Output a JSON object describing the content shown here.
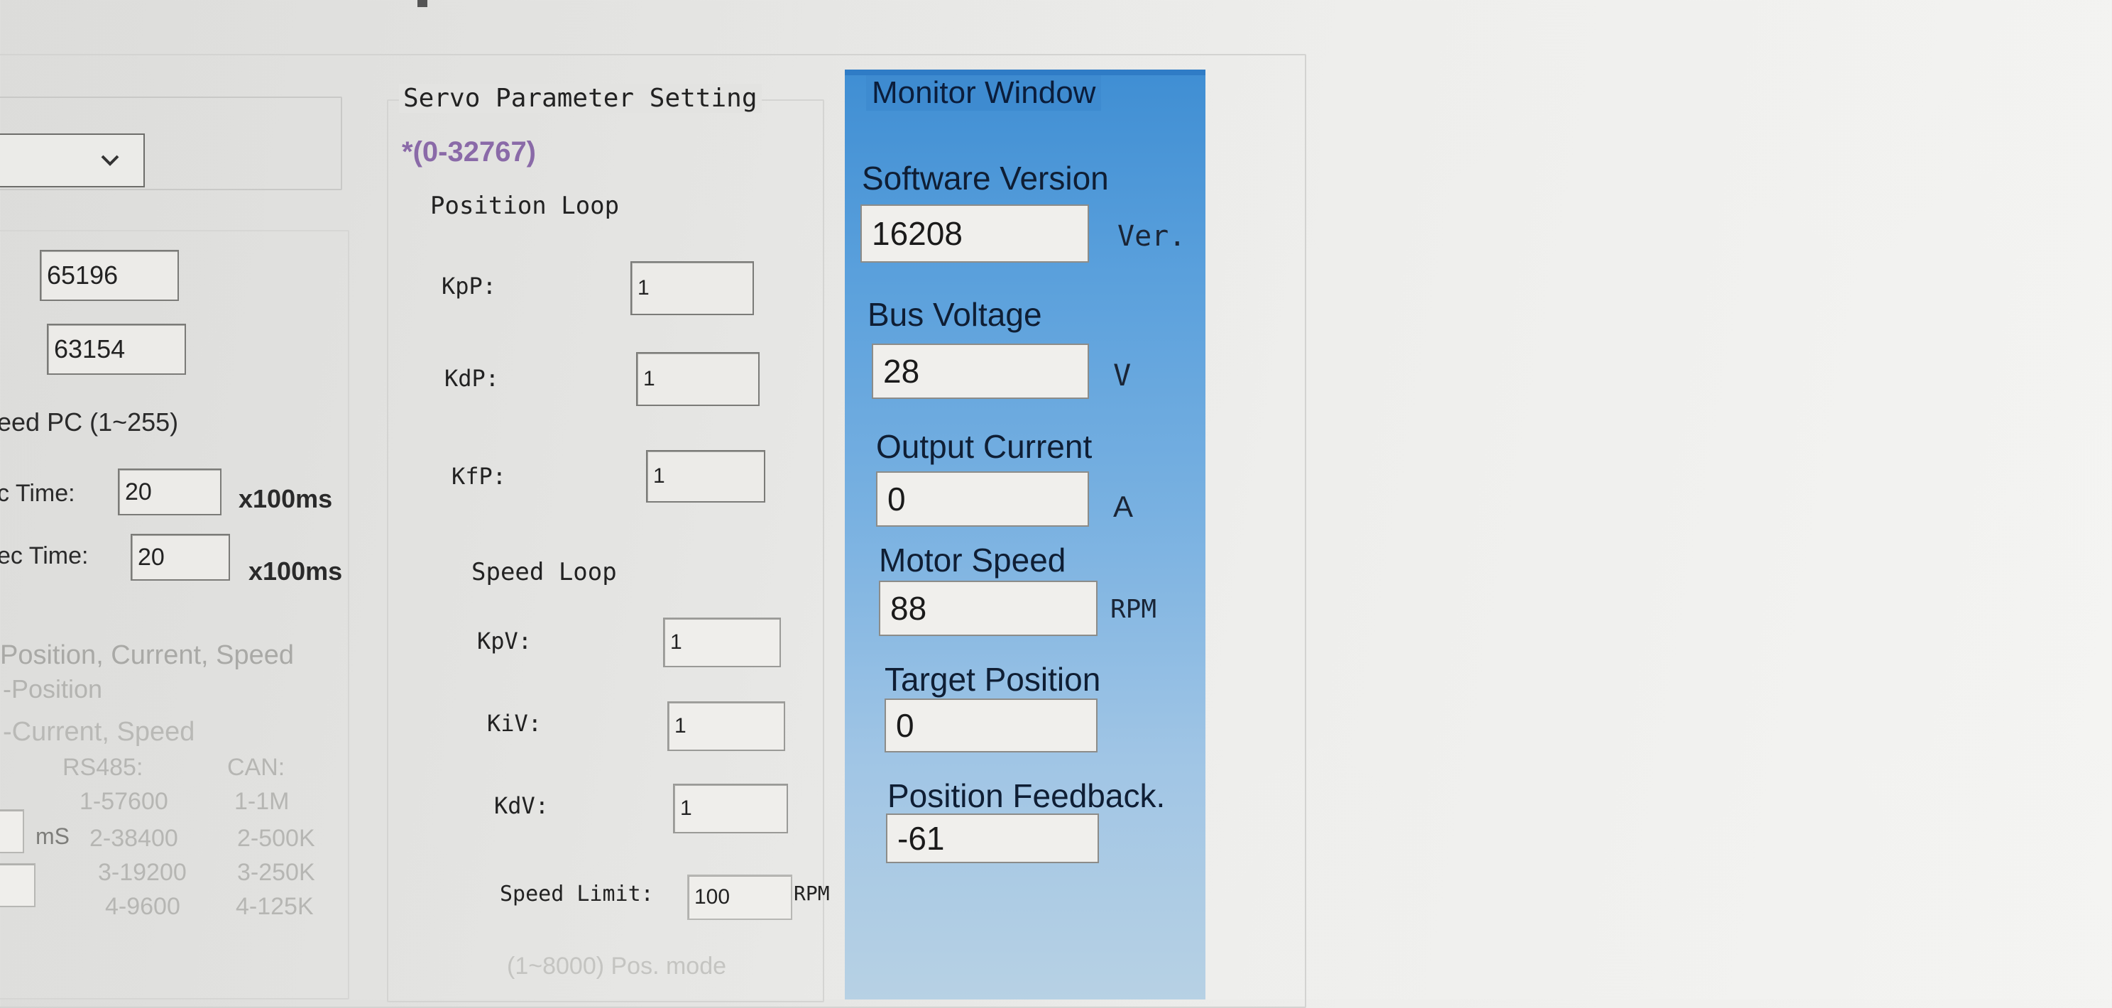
{
  "left_panel": {
    "field_1": "65196",
    "field_2": "63154",
    "speed_pc_label": "eed PC (1~255)",
    "acc_time_label": "c Time:",
    "acc_time_value": "20",
    "acc_time_unit": "x100ms",
    "dec_time_label": "ec Time:",
    "dec_time_value": "20",
    "dec_time_unit": "x100ms",
    "mode_line_1": "Position, Current, Speed",
    "mode_line_2": "-Position",
    "mode_line_3": "-Current, Speed",
    "baud_header_rs485": "RS485:",
    "baud_header_can": "CAN:",
    "ms_label": "mS",
    "rs485_options": [
      "1-57600",
      "2-38400",
      "3-19200",
      "4-9600"
    ],
    "can_options": [
      "1-1M",
      "2-500K",
      "3-250K",
      "4-125K"
    ]
  },
  "servo": {
    "title": "Servo Parameter Setting",
    "range_note": "*(0-32767)",
    "position_loop": "Position Loop",
    "kpp_label": "KpP:",
    "kpp_value": "1",
    "kdp_label": "KdP:",
    "kdp_value": "1",
    "kfp_label": "KfP:",
    "kfp_value": "1",
    "speed_loop": "Speed Loop",
    "kpv_label": "KpV:",
    "kpv_value": "1",
    "kiv_label": "KiV:",
    "kiv_value": "1",
    "kdv_label": "KdV:",
    "kdv_value": "1",
    "speed_limit_label": "Speed Limit:",
    "speed_limit_value": "100",
    "speed_limit_unit": "RPM",
    "bottom_note": "(1~8000) Pos. mode"
  },
  "monitor": {
    "title": "Monitor Window",
    "software_version_label": "Software Version",
    "software_version_value": "16208",
    "software_version_unit": "Ver.",
    "bus_voltage_label": "Bus Voltage",
    "bus_voltage_value": "28",
    "bus_voltage_unit": "V",
    "output_current_label": "Output Current",
    "output_current_value": "0",
    "output_current_unit": "A",
    "motor_speed_label": "Motor Speed",
    "motor_speed_value": "88",
    "motor_speed_unit": "RPM",
    "target_position_label": "Target Position",
    "target_position_value": "0",
    "position_feedback_label": "Position Feedback.",
    "position_feedback_value": "-61"
  },
  "icons": {
    "combo_arrow": "chevron-down-icon"
  },
  "colors": {
    "monitor_top": "#3f8ed3",
    "monitor_bottom": "#b7d1e4",
    "background": "#e6e6e4"
  }
}
